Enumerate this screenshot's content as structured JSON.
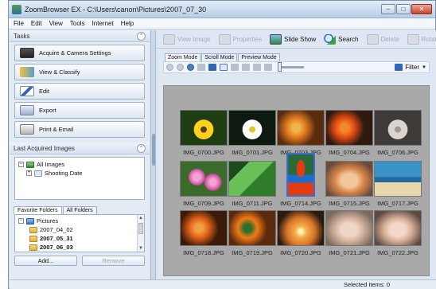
{
  "window": {
    "title": "ZoomBrowser EX - C:\\Users\\canon\\Pictures\\2007_07_30"
  },
  "menu": [
    "File",
    "Edit",
    "View",
    "Tools",
    "Internet",
    "Help"
  ],
  "tasks": {
    "title": "Tasks",
    "items": [
      {
        "label": "Acquire & Camera Settings",
        "icon": "camera-icon"
      },
      {
        "label": "View & Classify",
        "icon": "folders-icon"
      },
      {
        "label": "Edit",
        "icon": "pencil-icon"
      },
      {
        "label": "Export",
        "icon": "export-icon"
      },
      {
        "label": "Print & Email",
        "icon": "printer-icon"
      }
    ]
  },
  "last_acquired": {
    "title": "Last Acquired Images",
    "tree": [
      "All Images",
      "Shooting Date"
    ]
  },
  "folders": {
    "tabs": [
      "Favorite Folders",
      "All Folders"
    ],
    "items": [
      "Pictures",
      "2007_04_02",
      "2007_05_31",
      "2007_06_03"
    ],
    "add": "Add...",
    "remove": "Remove"
  },
  "toolbar": [
    {
      "label": "View Image",
      "enabled": false,
      "icon": "view-image-icon"
    },
    {
      "label": "Properties",
      "enabled": false,
      "icon": "properties-icon"
    },
    {
      "label": "Slide Show",
      "enabled": true,
      "icon": "slideshow-icon"
    },
    {
      "label": "Search",
      "enabled": true,
      "icon": "search-icon"
    },
    {
      "label": "Delete",
      "enabled": false,
      "icon": "trash-icon"
    },
    {
      "label": "Rotat",
      "enabled": false,
      "icon": "rotate-icon"
    }
  ],
  "mode_tabs": [
    "Zoom Mode",
    "Scroll Mode",
    "Preview Mode"
  ],
  "viewbar": {
    "filter": "Filter"
  },
  "thumbnails": [
    {
      "name": "IMG_0700.JPG",
      "colors": [
        "#1f3d12",
        "#ffd21f",
        "#5a3a10"
      ],
      "kind": "sunflower"
    },
    {
      "name": "IMG_0701.JPG",
      "colors": [
        "#0e1a10",
        "#ffffff",
        "#e6c12c"
      ],
      "kind": "daisy"
    },
    {
      "name": "IMG_0703.JPG",
      "colors": [
        "#5a2c0f",
        "#e07a1e",
        "#f2b34a"
      ],
      "kind": "orange"
    },
    {
      "name": "IMG_0704.JPG",
      "colors": [
        "#2d1b0f",
        "#e54b13",
        "#f28a2c"
      ],
      "kind": "orange"
    },
    {
      "name": "IMG_0706.JPG",
      "colors": [
        "#3d3a38",
        "#dcd5cf",
        "#a09890"
      ],
      "kind": "flower"
    },
    {
      "name": "IMG_0709.JPG",
      "colors": [
        "#3a6b2a",
        "#d94fa5",
        "#f1a6d4"
      ],
      "kind": "pink"
    },
    {
      "name": "IMG_0711.JPG",
      "colors": [
        "#1d4a1e",
        "#6bbf59",
        "#2f7c2b"
      ],
      "kind": "leaf"
    },
    {
      "name": "IMG_0714.JPG",
      "colors": [
        "#2a6a3a",
        "#e43c12",
        "#1c6ec8"
      ],
      "kind": "parrot"
    },
    {
      "name": "IMG_0715.JPG",
      "colors": [
        "#6a4b3a",
        "#f3c79b",
        "#d9874a"
      ],
      "kind": "kitten"
    },
    {
      "name": "IMG_0717.JPG",
      "colors": [
        "#3a93c7",
        "#e8d7a8",
        "#1f6aa3"
      ],
      "kind": "beach"
    },
    {
      "name": "IMG_0718.JPG",
      "colors": [
        "#3b1a08",
        "#e0601a",
        "#f0a040"
      ],
      "kind": "orange"
    },
    {
      "name": "IMG_0719.JPG",
      "colors": [
        "#5b2a0c",
        "#f07a18",
        "#2f6e2a"
      ],
      "kind": "orange"
    },
    {
      "name": "IMG_0720.JPG",
      "colors": [
        "#2a1a10",
        "#f5b04a",
        "#d8752a"
      ],
      "kind": "sunset"
    },
    {
      "name": "IMG_0721.JPG",
      "colors": [
        "#7a6a60",
        "#f0d6c4",
        "#cfb09a"
      ],
      "kind": "baby"
    },
    {
      "name": "IMG_0722.JPG",
      "colors": [
        "#5a4a40",
        "#f2d8c8",
        "#d3aa94"
      ],
      "kind": "baby"
    }
  ],
  "status": "Selected Items: 0"
}
